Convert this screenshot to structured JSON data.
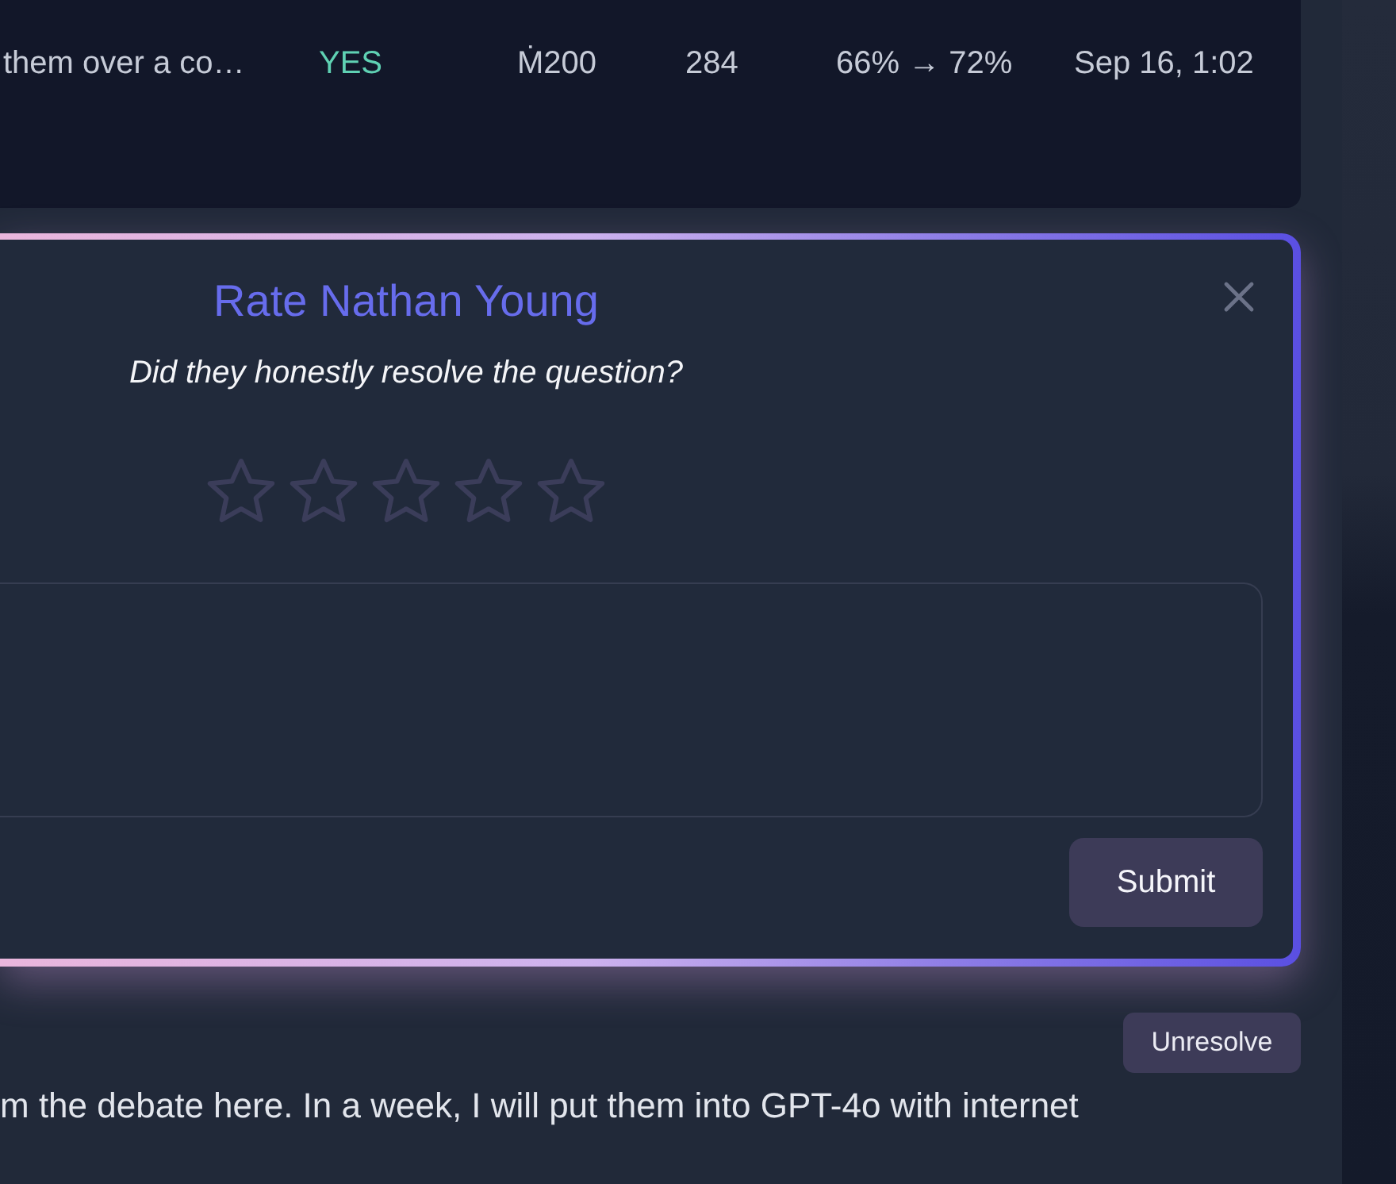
{
  "table": {
    "rows": [
      {
        "cells": [
          {
            "kind": "text",
            "text": "them over a co…"
          },
          {
            "kind": "outcome",
            "text": "YES"
          },
          {
            "kind": "text",
            "text": "Ṁ200"
          },
          {
            "kind": "text",
            "text": "284"
          },
          {
            "kind": "text",
            "text": "66% → 72%"
          },
          {
            "kind": "text",
            "text": "Sep 16, 1:02"
          }
        ]
      }
    ]
  },
  "rating_dialog": {
    "title": "Rate Nathan Young",
    "question": "Did they honestly resolve the question?",
    "stars": 0,
    "submit_button": "Submit"
  },
  "unresolve_button": "Unresolve",
  "comment_text": "m the debate here. In a week, I will put them into GPT-4o with internet"
}
